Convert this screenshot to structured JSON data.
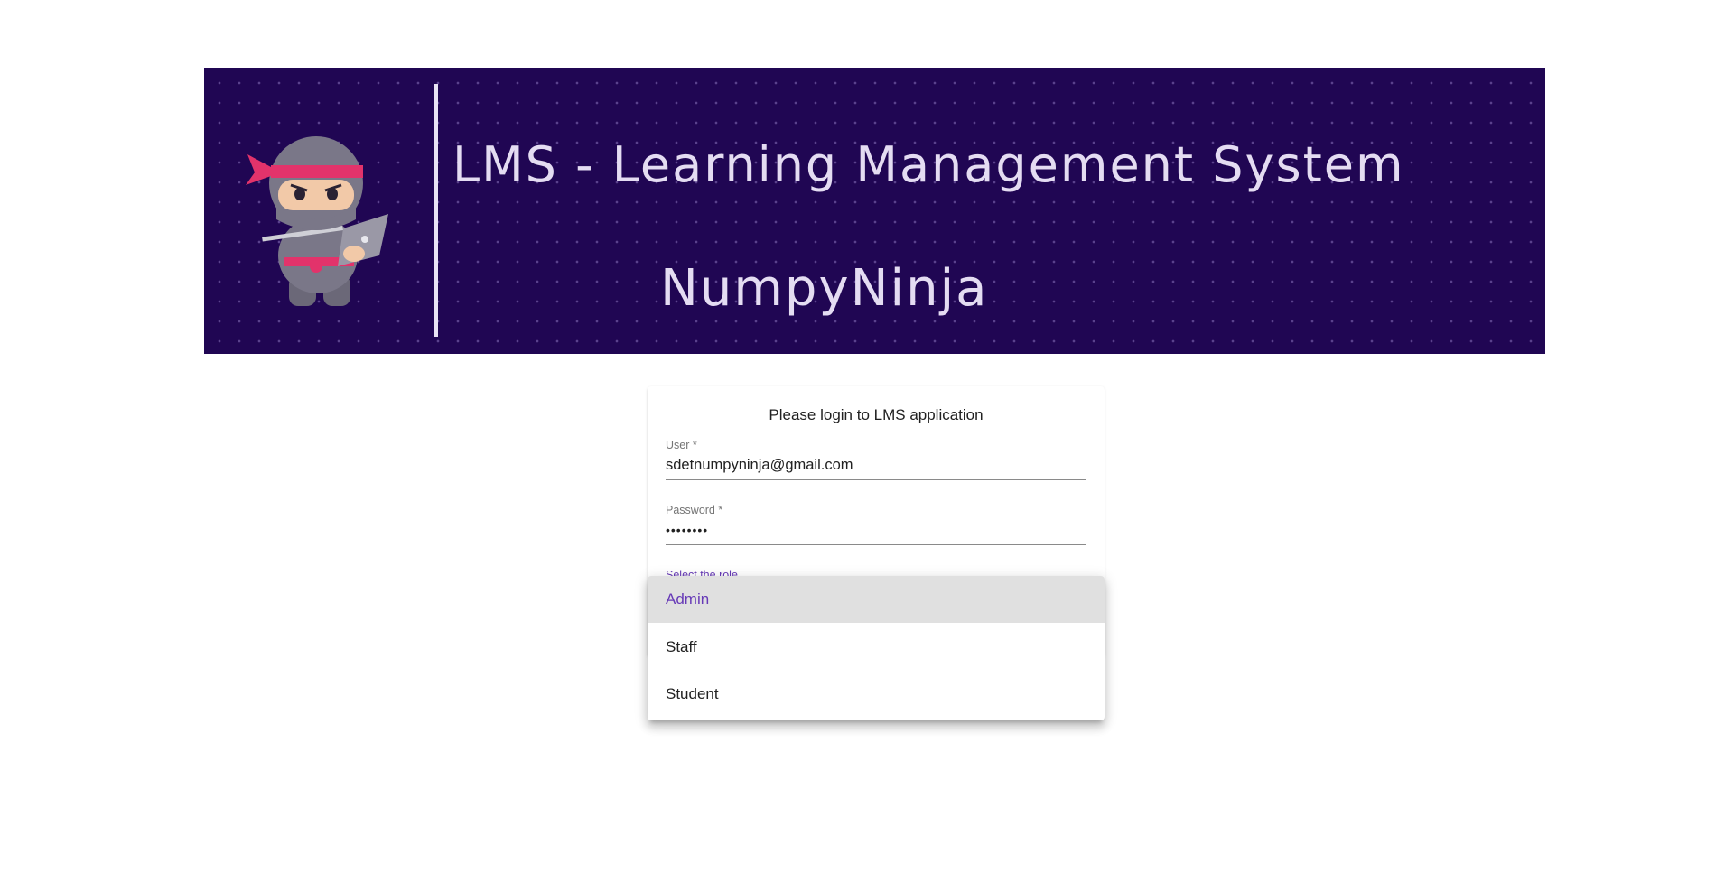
{
  "banner": {
    "title": "LMS - Learning Management System",
    "brand": "NumpyNinja",
    "background_color": "#200653",
    "logo_icon": "ninja-mascot-icon"
  },
  "login": {
    "heading": "Please login to LMS application",
    "user": {
      "label": "User *",
      "value": "sdetnumpyninja@gmail.com"
    },
    "password": {
      "label": "Password *",
      "value": "••••••••"
    },
    "role": {
      "label": "Select the role",
      "options": [
        "Admin",
        "Staff",
        "Student"
      ],
      "highlighted": "Admin"
    }
  },
  "colors": {
    "accent": "#673ab7",
    "highlight_bg": "#e0e0e0"
  }
}
